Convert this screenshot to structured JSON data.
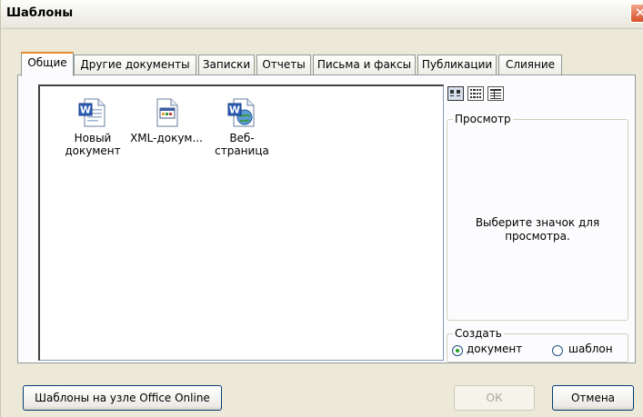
{
  "window": {
    "title": "Шаблоны",
    "close_symbol": "✕"
  },
  "tabs": [
    {
      "label": "Общие",
      "active": true
    },
    {
      "label": "Другие документы"
    },
    {
      "label": "Записки"
    },
    {
      "label": "Отчеты"
    },
    {
      "label": "Письма и факсы"
    },
    {
      "label": "Публикации"
    },
    {
      "label": "Слияние"
    }
  ],
  "templates": [
    {
      "label": "Новый документ",
      "icon": "word-document-icon"
    },
    {
      "label": "XML-докум...",
      "icon": "xml-document-icon"
    },
    {
      "label": "Веб-страница",
      "icon": "web-page-icon"
    }
  ],
  "view_buttons": [
    "large-icons-view-icon",
    "list-view-icon",
    "details-view-icon"
  ],
  "preview": {
    "label": "Просмотр",
    "text": "Выберите значок для просмотра."
  },
  "create": {
    "label": "Создать",
    "options": [
      "документ",
      "шаблон"
    ],
    "selected": "документ"
  },
  "buttons": {
    "online": "Шаблоны на узле Office Online",
    "ok": "ОК",
    "cancel": "Отмена"
  },
  "colors": {
    "tab_highlight": "#e68b2c",
    "dialog_bg": "#ece9d8",
    "close_button": "#d9512b"
  }
}
